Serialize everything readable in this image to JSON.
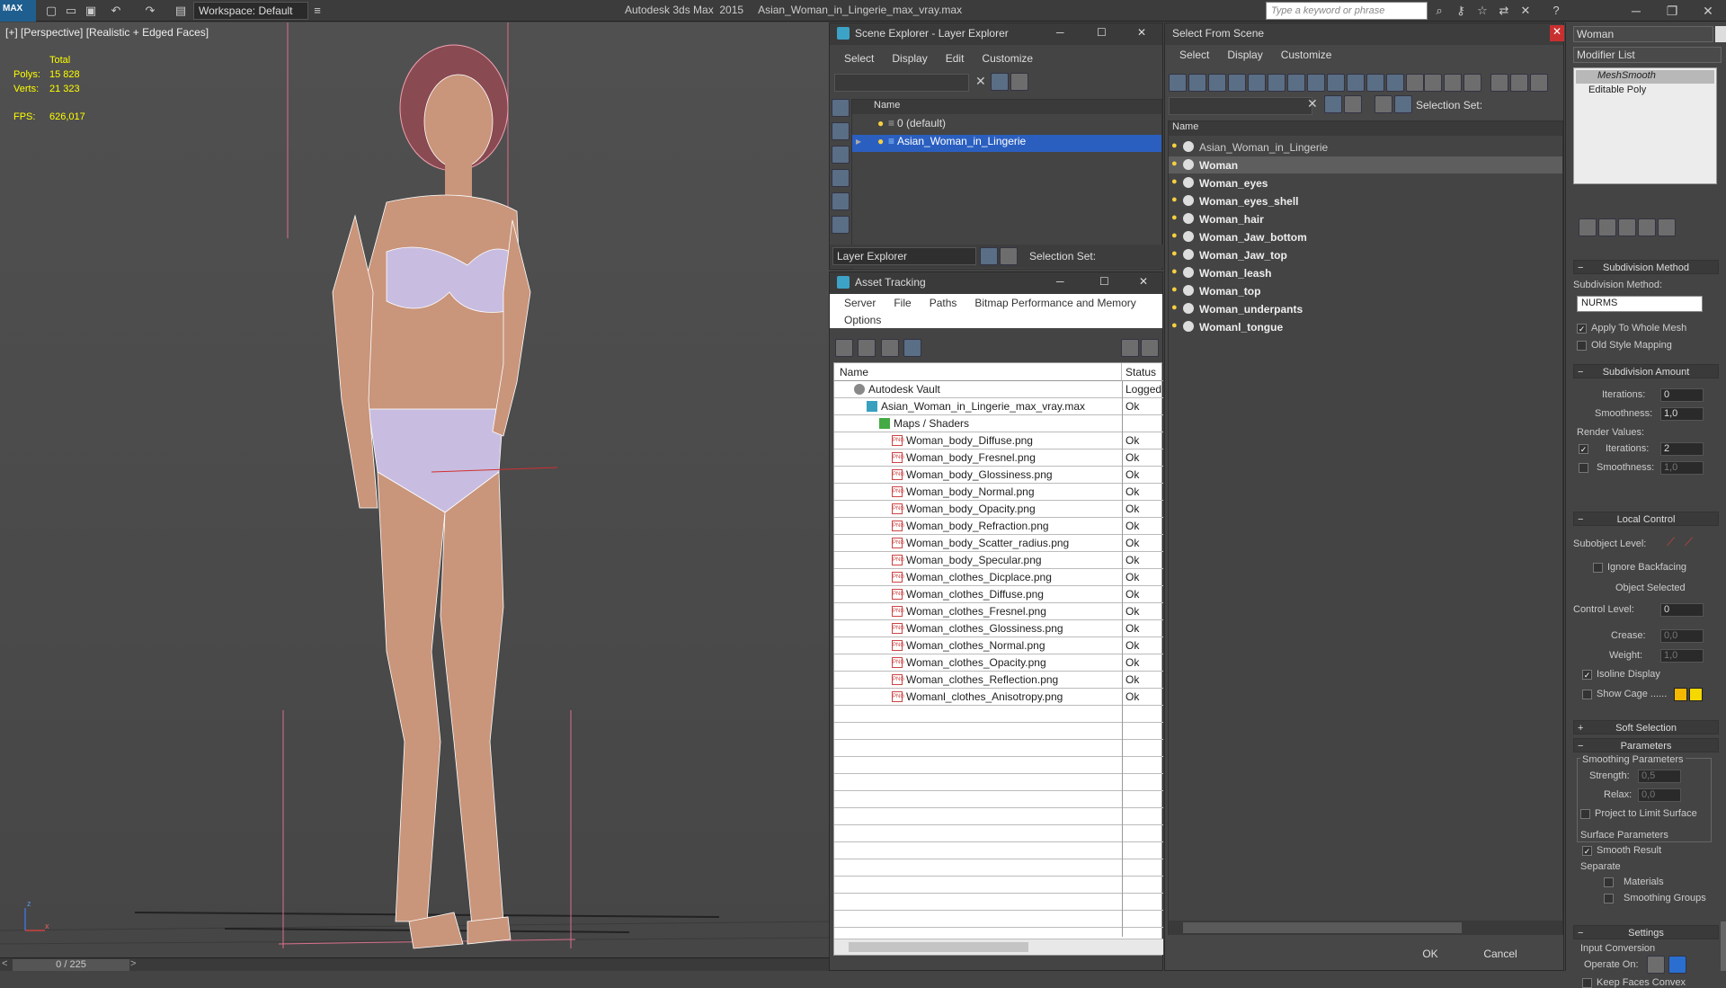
{
  "app": {
    "logo_text": "MAX",
    "workspace": "Workspace: Default",
    "title": "Autodesk 3ds Max  2015     Asian_Woman_in_Lingerie_max_vray.max",
    "search_placeholder": "Type a keyword or phrase"
  },
  "viewport": {
    "label": "[+] [Perspective] [Realistic + Edged Faces]",
    "stats": {
      "total_label": "Total",
      "polys_label": "Polys:",
      "polys": "15 828",
      "verts_label": "Verts:",
      "verts": "21 323",
      "fps_label": "FPS:",
      "fps": "626,017"
    },
    "timeline": "0 / 225",
    "axis_x": "x",
    "axis_z": "z"
  },
  "layer_explorer": {
    "title": "Scene Explorer - Layer Explorer",
    "menu": [
      "Select",
      "Display",
      "Edit",
      "Customize"
    ],
    "col_name": "Name",
    "rows": [
      "0 (default)",
      "Asian_Woman_in_Lingerie"
    ],
    "footer_dropdown": "Layer Explorer",
    "selection_set": "Selection Set:"
  },
  "asset_tracking": {
    "title": "Asset Tracking",
    "menu": [
      "Server",
      "File",
      "Paths",
      "Bitmap Performance and Memory"
    ],
    "menu2": "Options",
    "col_name": "Name",
    "col_status": "Status",
    "rows": [
      {
        "name": "Autodesk Vault",
        "status": "Logged",
        "indent": 0,
        "icon": "vault-icon"
      },
      {
        "name": "Asian_Woman_in_Lingerie_max_vray.max",
        "status": "Ok",
        "indent": 1,
        "icon": "max-file-icon"
      },
      {
        "name": "Maps / Shaders",
        "status": "",
        "indent": 2,
        "icon": "maps-icon"
      },
      {
        "name": "Woman_body_Diffuse.png",
        "status": "Ok",
        "indent": 3,
        "icon": "png-icon"
      },
      {
        "name": "Woman_body_Fresnel.png",
        "status": "Ok",
        "indent": 3,
        "icon": "png-icon"
      },
      {
        "name": "Woman_body_Glossiness.png",
        "status": "Ok",
        "indent": 3,
        "icon": "png-icon"
      },
      {
        "name": "Woman_body_Normal.png",
        "status": "Ok",
        "indent": 3,
        "icon": "png-icon"
      },
      {
        "name": "Woman_body_Opacity.png",
        "status": "Ok",
        "indent": 3,
        "icon": "png-icon"
      },
      {
        "name": "Woman_body_Refraction.png",
        "status": "Ok",
        "indent": 3,
        "icon": "png-icon"
      },
      {
        "name": "Woman_body_Scatter_radius.png",
        "status": "Ok",
        "indent": 3,
        "icon": "png-icon"
      },
      {
        "name": "Woman_body_Specular.png",
        "status": "Ok",
        "indent": 3,
        "icon": "png-icon"
      },
      {
        "name": "Woman_clothes_Dicplace.png",
        "status": "Ok",
        "indent": 3,
        "icon": "png-icon"
      },
      {
        "name": "Woman_clothes_Diffuse.png",
        "status": "Ok",
        "indent": 3,
        "icon": "png-icon"
      },
      {
        "name": "Woman_clothes_Fresnel.png",
        "status": "Ok",
        "indent": 3,
        "icon": "png-icon"
      },
      {
        "name": "Woman_clothes_Glossiness.png",
        "status": "Ok",
        "indent": 3,
        "icon": "png-icon"
      },
      {
        "name": "Woman_clothes_Normal.png",
        "status": "Ok",
        "indent": 3,
        "icon": "png-icon"
      },
      {
        "name": "Woman_clothes_Opacity.png",
        "status": "Ok",
        "indent": 3,
        "icon": "png-icon"
      },
      {
        "name": "Woman_clothes_Reflection.png",
        "status": "Ok",
        "indent": 3,
        "icon": "png-icon"
      },
      {
        "name": "Womanl_clothes_Anisotropy.png",
        "status": "Ok",
        "indent": 3,
        "icon": "png-icon"
      }
    ]
  },
  "select_from_scene": {
    "title": "Select From Scene",
    "menu": [
      "Select",
      "Display",
      "Customize"
    ],
    "selection_set": "Selection Set:",
    "col_name": "Name",
    "rows": [
      {
        "name": "Asian_Woman_in_Lingerie",
        "bold": false,
        "selected": false
      },
      {
        "name": "Woman",
        "bold": true,
        "selected": true
      },
      {
        "name": "Woman_eyes",
        "bold": true,
        "selected": false
      },
      {
        "name": "Woman_eyes_shell",
        "bold": true,
        "selected": false
      },
      {
        "name": "Woman_hair",
        "bold": true,
        "selected": false
      },
      {
        "name": "Woman_Jaw_bottom",
        "bold": true,
        "selected": false
      },
      {
        "name": "Woman_Jaw_top",
        "bold": true,
        "selected": false
      },
      {
        "name": "Woman_leash",
        "bold": true,
        "selected": false
      },
      {
        "name": "Woman_top",
        "bold": true,
        "selected": false
      },
      {
        "name": "Woman_underpants",
        "bold": true,
        "selected": false
      },
      {
        "name": "Womanl_tongue",
        "bold": true,
        "selected": false
      }
    ],
    "ok": "OK",
    "cancel": "Cancel"
  },
  "modify_panel": {
    "object_name": "Woman",
    "modifier_list": "Modifier List",
    "stack": [
      "MeshSmooth",
      "Editable Poly"
    ],
    "subdivision_method": {
      "header": "Subdivision Method",
      "label": "Subdivision Method:",
      "value": "NURMS",
      "apply_whole_mesh": "Apply To Whole Mesh",
      "old_style_mapping": "Old Style Mapping"
    },
    "subdivision_amount": {
      "header": "Subdivision Amount",
      "iterations_label": "Iterations:",
      "iterations": "0",
      "smoothness_label": "Smoothness:",
      "smoothness": "1,0",
      "render_values": "Render Values:",
      "r_iterations_label": "Iterations:",
      "r_iterations": "2",
      "r_smoothness_label": "Smoothness:",
      "r_smoothness": "1,0"
    },
    "local_control": {
      "header": "Local Control",
      "subobject_level": "Subobject Level:",
      "ignore_backfacing": "Ignore Backfacing",
      "object_selected": "Object Selected",
      "control_level_label": "Control Level:",
      "control_level": "0",
      "crease_label": "Crease:",
      "crease": "0,0",
      "weight_label": "Weight:",
      "weight": "1,0",
      "isoline_display": "Isoline Display",
      "show_cage": "Show Cage ......"
    },
    "soft_selection": {
      "header": "Soft Selection"
    },
    "parameters": {
      "header": "Parameters",
      "smoothing_params": "Smoothing Parameters",
      "strength_label": "Strength:",
      "strength": "0,5",
      "relax_label": "Relax:",
      "relax": "0,0",
      "project_limit": "Project to Limit Surface",
      "surface_params": "Surface Parameters",
      "smooth_result": "Smooth Result",
      "separate": "Separate",
      "materials": "Materials",
      "smoothing_groups": "Smoothing Groups"
    },
    "settings": {
      "header": "Settings",
      "input_conversion": "Input Conversion",
      "operate_on": "Operate On:",
      "keep_faces_convex": "Keep Faces Convex"
    },
    "colors": {
      "cage1": "#f5b800",
      "cage2": "#f5d800"
    }
  }
}
